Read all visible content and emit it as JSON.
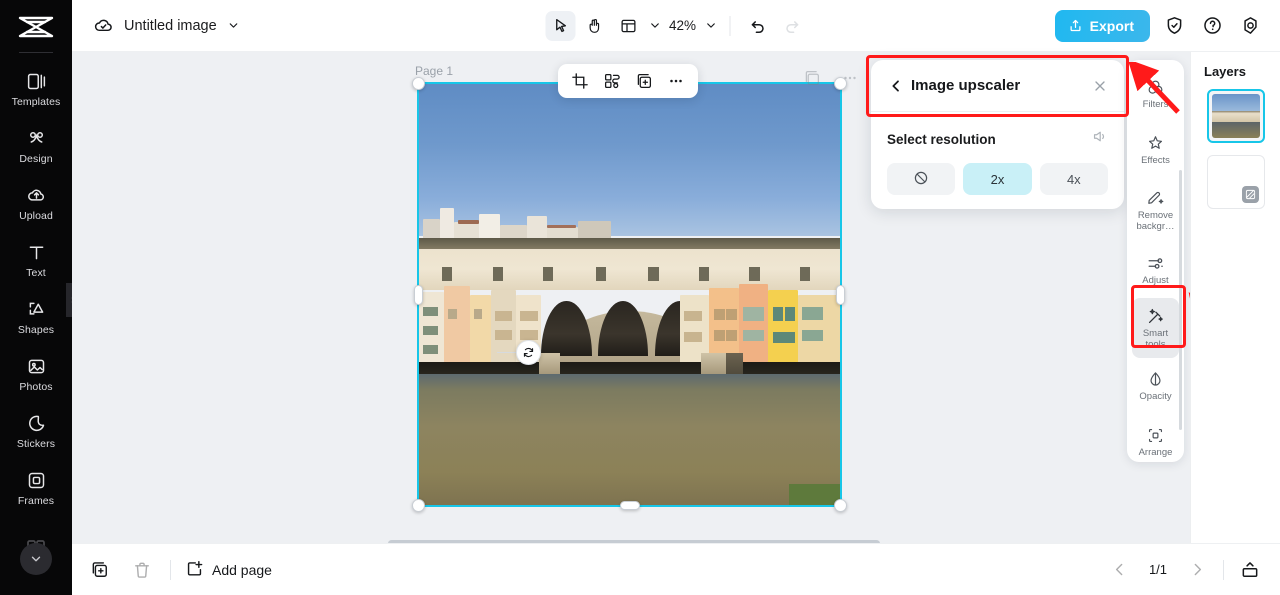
{
  "app": {
    "brand": "logo-mark"
  },
  "left_sidebar": {
    "items": [
      {
        "label": "Templates",
        "icon": "templates-icon"
      },
      {
        "label": "Design",
        "icon": "design-icon"
      },
      {
        "label": "Upload",
        "icon": "upload-cloud-icon"
      },
      {
        "label": "Text",
        "icon": "text-icon"
      },
      {
        "label": "Shapes",
        "icon": "shapes-icon"
      },
      {
        "label": "Photos",
        "icon": "photos-icon"
      },
      {
        "label": "Stickers",
        "icon": "stickers-icon"
      },
      {
        "label": "Frames",
        "icon": "frames-icon"
      }
    ],
    "expand_icon": "chevron-down-icon"
  },
  "topbar": {
    "cloud_icon": "cloud-saved-icon",
    "document_title": "Untitled image",
    "title_caret_icon": "chevron-down-icon",
    "tools": [
      {
        "name": "select-tool",
        "icon": "cursor-arrow-icon",
        "active": true
      },
      {
        "name": "hand-tool",
        "icon": "hand-icon",
        "active": false
      },
      {
        "name": "layout-tool",
        "icon": "layout-grid-icon",
        "active": false
      }
    ],
    "layout_caret_icon": "chevron-down-icon",
    "zoom_level": "42%",
    "zoom_caret_icon": "chevron-down-icon",
    "undo_icon": "undo-arrow-icon",
    "redo_icon": "redo-arrow-icon",
    "redo_disabled": true,
    "export_label": "Export",
    "export_icon": "upload-share-icon",
    "export_color": "#25b6ef",
    "shield_icon": "shield-check-icon",
    "help_icon": "question-circle-icon",
    "settings_icon": "gear-icon"
  },
  "canvas": {
    "page_label": "Page 1",
    "float_toolbar": [
      {
        "name": "crop-button",
        "icon": "crop-icon"
      },
      {
        "name": "segment-button",
        "icon": "segment-icon"
      },
      {
        "name": "duplicate-button",
        "icon": "duplicate-icon"
      },
      {
        "name": "more-options-button",
        "icon": "ellipsis-icon"
      }
    ],
    "ghost_tools": [
      {
        "name": "duplicate-ghost-button",
        "icon": "duplicate-icon"
      },
      {
        "name": "more-ghost-button",
        "icon": "ellipsis-icon"
      }
    ],
    "rotate_icon": "rotate-icon",
    "selection_color": "#17c6e8",
    "image_alt": "Ponte Vecchio bridge over the Arno river in Florence"
  },
  "upscaler_panel": {
    "back_icon": "chevron-left-icon",
    "title": "Image upscaler",
    "close_icon": "close-x-icon",
    "section_label": "Select resolution",
    "info_icon": "announce-icon",
    "options": [
      {
        "label": "",
        "icon": "no-none-icon",
        "name": "resolution-none",
        "selected": false
      },
      {
        "label": "2x",
        "icon": "",
        "name": "resolution-2x",
        "selected": true
      },
      {
        "label": "4x",
        "icon": "",
        "name": "resolution-4x",
        "selected": false
      }
    ],
    "highlight_color": "#ff1a1a",
    "selected_bg": "#c9f0f7"
  },
  "tool_rail": {
    "items": [
      {
        "label": "Filters",
        "icon": "filters-icon",
        "active": false
      },
      {
        "label": "Effects",
        "icon": "effects-icon",
        "active": false
      },
      {
        "label": "Remove backgr…",
        "icon": "remove-background-icon",
        "active": false
      },
      {
        "label": "Adjust",
        "icon": "adjust-sliders-icon",
        "active": false
      },
      {
        "label": "Smart tools",
        "icon": "magic-wand-icon",
        "active": true
      },
      {
        "label": "Opacity",
        "icon": "opacity-drop-icon",
        "active": false
      },
      {
        "label": "Arrange",
        "icon": "arrange-icon",
        "active": false
      }
    ]
  },
  "layers_panel": {
    "title": "Layers",
    "layers": [
      {
        "name": "layer-image",
        "type": "image",
        "selected": true
      },
      {
        "name": "layer-background",
        "type": "blank",
        "selected": false,
        "badge_icon": "transparent-swatch-icon"
      }
    ]
  },
  "bottombar": {
    "duplicate_page_icon": "duplicate-page-icon",
    "delete_page_icon": "trash-icon",
    "add_page_icon": "add-page-icon",
    "add_page_label": "Add page",
    "prev_icon": "chevron-left-icon",
    "page_indicator": "1/1",
    "next_icon": "chevron-right-icon",
    "fit_icon": "fit-screen-icon"
  }
}
